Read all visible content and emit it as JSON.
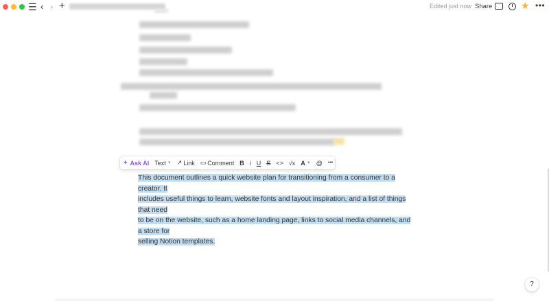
{
  "topbar": {
    "edited_status": "Edited just now",
    "share_label": "Share",
    "icons": [
      "sidebar-menu-icon",
      "back-arrow-icon",
      "forward-arrow-icon",
      "plus-icon",
      "comments-icon",
      "updates-clock-icon",
      "favorite-star-icon",
      "more-icon"
    ]
  },
  "toolbar": {
    "ask_ai": "Ask AI",
    "text": "Text",
    "link": "Link",
    "comment": "Comment",
    "bold": "B",
    "italic": "i",
    "underline": "U",
    "strike": "S",
    "code": "<>",
    "equation": "√x",
    "color": "A",
    "mention": "@",
    "more": "•••"
  },
  "paragraph": {
    "lines": [
      "This document outlines a quick website plan for transitioning from a consumer to a creator. It",
      "includes useful things to learn, website fonts and layout inspiration, and a list of things that need",
      "to be on the website, such as a home landing page, links to social media channels, and a store for",
      "selling Notion templates."
    ]
  },
  "help_label": "?",
  "colors": {
    "selection": "#c2dcf2",
    "ai_accent": "#8a5bd6",
    "star": "#f2b73a"
  }
}
